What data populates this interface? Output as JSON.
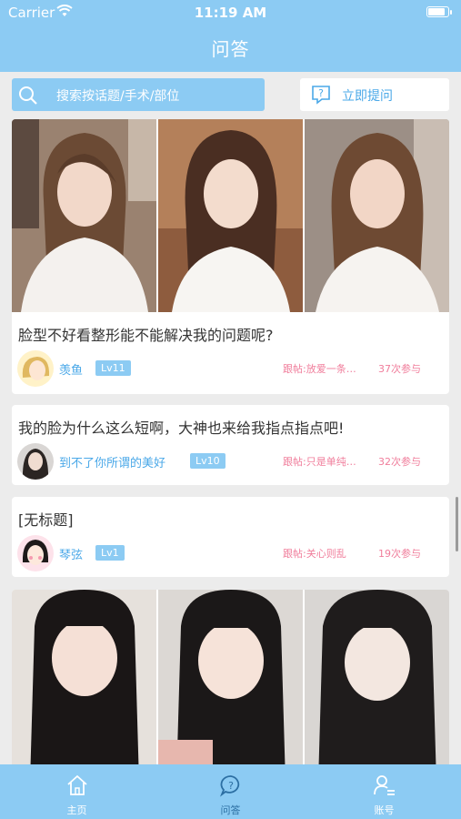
{
  "status": {
    "carrier": "Carrier",
    "time": "11:19 AM"
  },
  "header": {
    "title": "问答"
  },
  "search": {
    "placeholder": "搜索按话题/手术/部位"
  },
  "ask": {
    "label": "立即提问"
  },
  "posts": [
    {
      "title": "脸型不好看整形能不能解决我的问题呢?",
      "user": "羡鱼",
      "level": "Lv11",
      "follow": "跟帖:放爱一条…",
      "count": "37次参与",
      "photos": 3
    },
    {
      "title": "我的脸为什么这么短啊，大神也来给我指点指点吧!",
      "user": "到不了你所谓的美好",
      "level": "Lv10",
      "follow": "跟帖:只是单纯…",
      "count": "32次参与",
      "photos": 0
    },
    {
      "title": "[无标题]",
      "user": "琴弦",
      "level": "Lv1",
      "follow": "跟帖:关心则乱",
      "count": "19次参与",
      "photos": 0
    },
    {
      "title": "",
      "user": "",
      "level": "",
      "follow": "",
      "count": "",
      "photos": 3
    }
  ],
  "tabs": [
    {
      "label": "主页",
      "icon": "home-icon"
    },
    {
      "label": "问答",
      "icon": "chat-question-icon",
      "active": true
    },
    {
      "label": "账号",
      "icon": "user-list-icon"
    }
  ],
  "colors": {
    "primary": "#8ccbf3",
    "accent_text": "#4aa8e8",
    "pink": "#f07d9b"
  }
}
